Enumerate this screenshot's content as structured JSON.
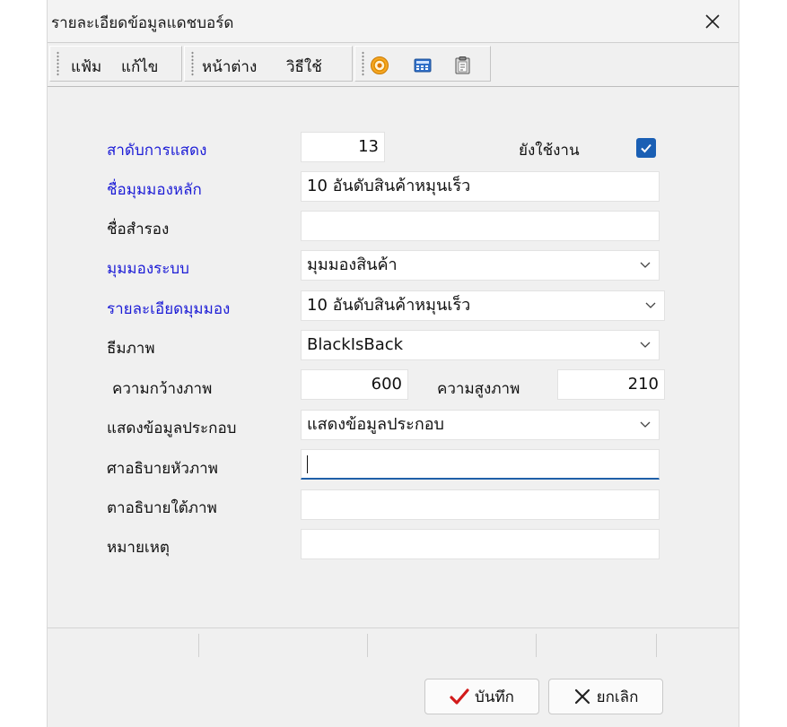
{
  "window": {
    "title": "รายละเอียดข้อมูลแดชบอร์ด"
  },
  "menu": {
    "file": "แฟ้ม",
    "edit": "แก้ไข",
    "window": "หน้าต่าง",
    "help": "วิธีใช้"
  },
  "toolbar_icons": [
    "target-icon",
    "calculator-icon",
    "clipboard-icon"
  ],
  "form": {
    "order_label": "สาดับการแสดง",
    "order_value": "13",
    "active_label": "ยังใช้งาน",
    "active_checked": true,
    "main_view_label": "ชื่อมุมมองหลัก",
    "main_view_value": "10 อันดับสินค้าหมุนเร็ว",
    "alt_name_label": "ชื่อสำรอง",
    "alt_name_value": "",
    "system_view_label": "มุมมองระบบ",
    "system_view_value": "มุมมองสินค้า",
    "view_detail_label": "รายละเอียดมุมมอง",
    "view_detail_value": "10 อันดับสินค้าหมุนเร็ว",
    "theme_label": "ธีมภาพ",
    "theme_value": "BlackIsBack",
    "width_label": "ความกว้างภาพ",
    "width_value": "600",
    "height_label": "ความสูงภาพ",
    "height_value": "210",
    "show_info_label": "แสดงข้อมูลประกอบ",
    "show_info_value": "แสดงข้อมูลประกอบ",
    "header_desc_label": "ศาอธิบายหัวภาพ",
    "header_desc_value": "",
    "footer_desc_label": "ตาอธิบายใต้ภาพ",
    "footer_desc_value": "",
    "note_label": "หมายเหตุ",
    "note_value": ""
  },
  "buttons": {
    "save": "บันทึก",
    "cancel": "ยกเลิก"
  },
  "colors": {
    "accent": "#1a5fb4",
    "required_label": "#1c1cd6"
  }
}
